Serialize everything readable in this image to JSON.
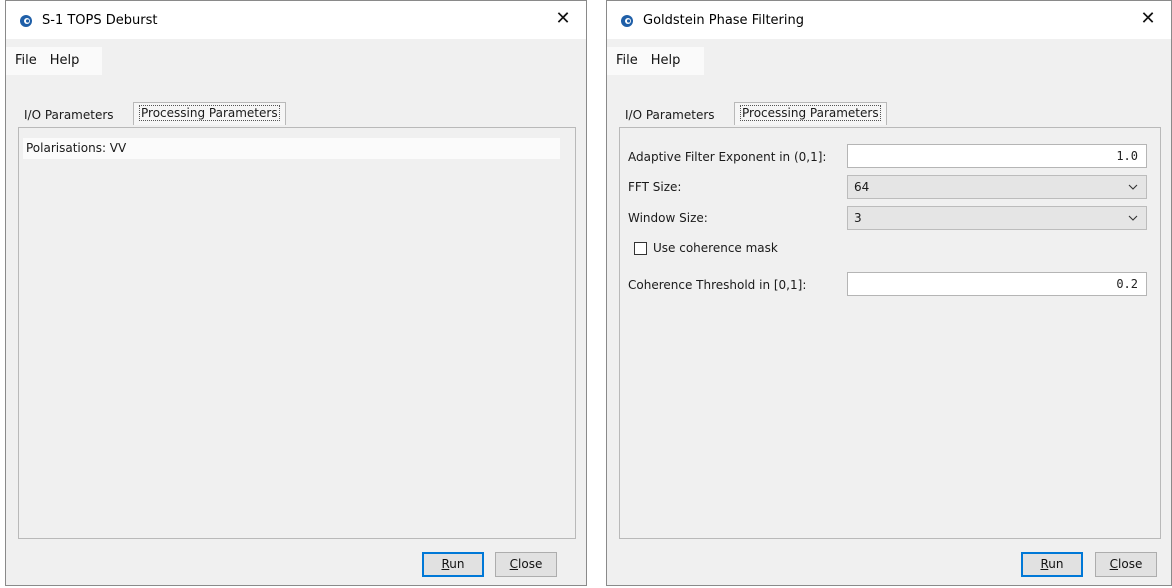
{
  "windows": [
    {
      "title": "S-1 TOPS Deburst",
      "menu": [
        "File",
        "Help"
      ],
      "tabs": [
        "I/O Parameters",
        "Processing Parameters"
      ],
      "active_tab": "Processing Parameters",
      "polarisations_text": "Polarisations: VV",
      "buttons": {
        "run_mnemonic": "R",
        "run_rest": "un",
        "close_mnemonic": "C",
        "close_rest": "lose"
      }
    },
    {
      "title": "Goldstein Phase Filtering",
      "menu": [
        "File",
        "Help"
      ],
      "tabs": [
        "I/O Parameters",
        "Processing Parameters"
      ],
      "active_tab": "Processing Parameters",
      "fields": {
        "adaptive_label": "Adaptive Filter Exponent in (0,1]:",
        "adaptive_value": "1.0",
        "fft_label": "FFT Size:",
        "fft_value": "64",
        "window_label": "Window Size:",
        "window_value": "3",
        "coherence_mask_label": "Use coherence mask",
        "coherence_mask_checked": false,
        "coherence_threshold_label": "Coherence Threshold in [0,1]:",
        "coherence_threshold_value": "0.2"
      },
      "buttons": {
        "run_mnemonic": "R",
        "run_rest": "un",
        "close_mnemonic": "C",
        "close_rest": "lose"
      }
    }
  ],
  "close_glyph": "✕",
  "colors": {
    "app_icon": "#1f5fa8",
    "default_button_border": "#0078d7"
  }
}
